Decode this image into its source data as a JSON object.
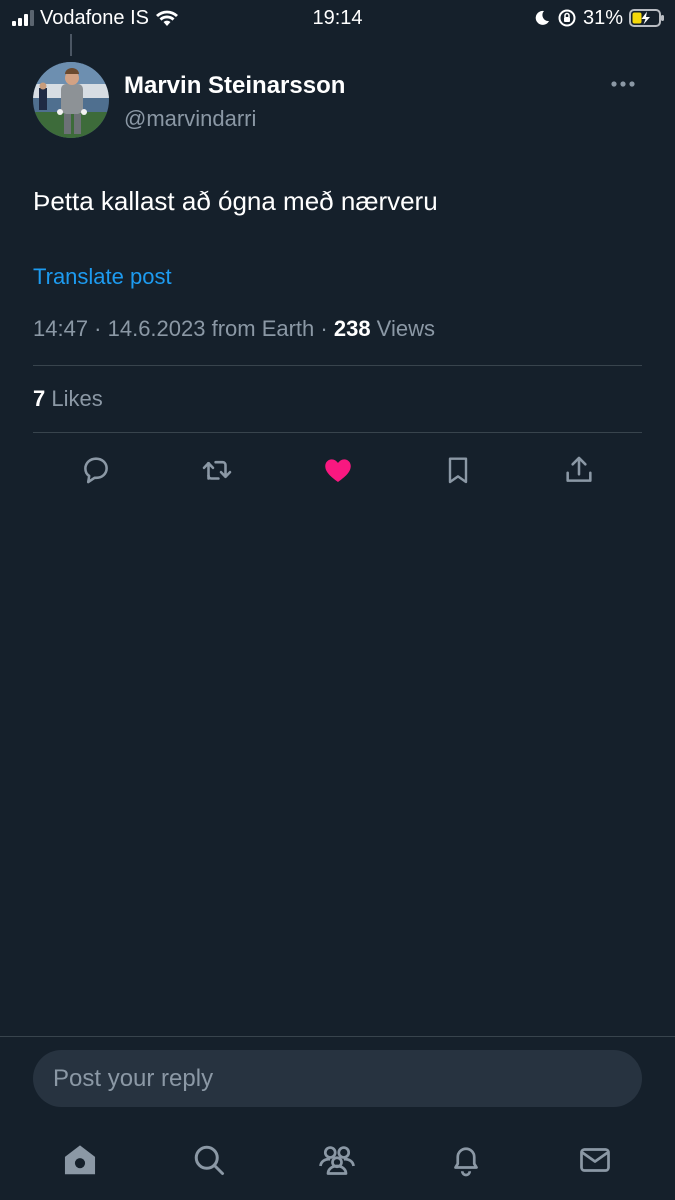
{
  "status_bar": {
    "carrier": "Vodafone IS",
    "time": "19:14",
    "battery": "31%"
  },
  "tweet": {
    "author_name": "Marvin Steinarsson",
    "author_handle": "@marvindarri",
    "text": "Þetta kallast að ógna með nærveru",
    "translate_label": "Translate post",
    "timestamp": "14:47 · 14.6.2023 from Earth · ",
    "views_count": "238",
    "views_label": " Views",
    "likes_count": "7",
    "likes_label": " Likes",
    "liked": true
  },
  "actions": {
    "icons": [
      "reply-icon",
      "retweet-icon",
      "like-icon",
      "bookmark-icon",
      "share-icon"
    ]
  },
  "reply": {
    "placeholder": "Post your reply"
  },
  "tab_bar": {
    "icons": [
      "home-icon",
      "search-icon",
      "communities-icon",
      "notifications-icon",
      "messages-icon"
    ]
  },
  "colors": {
    "background": "#15202b",
    "accent": "#1d9bf0",
    "like": "#f91880",
    "muted": "#8b98a5",
    "divider": "#38444d"
  }
}
